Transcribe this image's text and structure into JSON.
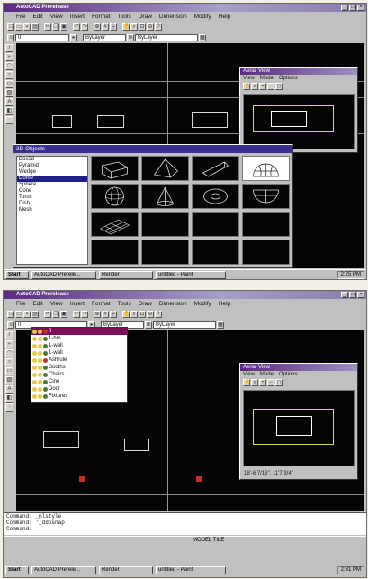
{
  "top": {
    "window_title": "AutoCAD Prerelease",
    "menu": [
      "File",
      "Edit",
      "View",
      "Insert",
      "Format",
      "Tools",
      "Draw",
      "Dimension",
      "Modify",
      "Help"
    ],
    "layer_combo": "0",
    "color_combo": "ByLayer",
    "linetype_combo": "ByLayer",
    "aerial": {
      "title": "Aerial View",
      "menu": [
        "View",
        "Mode",
        "Options"
      ]
    },
    "objects_dialog": {
      "title": "3D Objects",
      "items": [
        "Box3d",
        "Pyramid",
        "Wedge",
        "Dome",
        "Sphere",
        "Cone",
        "Torus",
        "Dish",
        "Mesh"
      ],
      "selected_index": 3
    },
    "taskbar": {
      "start": "Start",
      "tasks": [
        "AutoCAD Prerele...",
        "Render",
        "untitled - Paint"
      ],
      "clock": "2:25 PM"
    }
  },
  "bottom": {
    "window_title": "AutoCAD Prerelease",
    "menu": [
      "File",
      "Edit",
      "View",
      "Insert",
      "Format",
      "Tools",
      "Draw",
      "Dimension",
      "Modify",
      "Help"
    ],
    "layer_combo": "0",
    "color_combo": "ByLayer",
    "linetype_combo": "ByLayer",
    "layer_list": [
      "0",
      "1-hm",
      "1-wall",
      "1-wall",
      "Ashrule",
      "Booths",
      "Chairs",
      "Cine",
      "Door",
      "Fixtures"
    ],
    "layer_selected_index": 0,
    "aerial": {
      "title": "Aerial View",
      "menu": [
        "View",
        "Mode",
        "Options"
      ],
      "coords": "18'-6 7/16\", 11'7 3/4\""
    },
    "command_lines": [
      "Command: _mlstyle",
      "Command: '_ddosnap",
      "Command:"
    ],
    "status": "MODEL  TILE",
    "taskbar": {
      "start": "Start",
      "tasks": [
        "AutoCAD Prerele...",
        "Render",
        "untitled - Paint"
      ],
      "clock": "2:31 PM"
    }
  }
}
